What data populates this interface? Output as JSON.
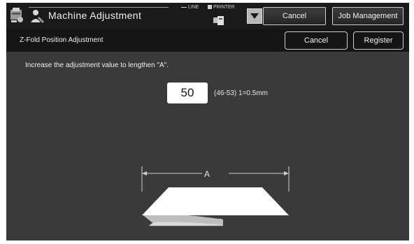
{
  "header": {
    "title": "Machine Adjustment",
    "line_label": "LINE",
    "printer_label": "PRINTER",
    "cancel_label": "Cancel",
    "job_management_label": "Job Management"
  },
  "subheader": {
    "title": "Z-Fold Position Adjustment",
    "cancel_label": "Cancel",
    "register_label": "Register"
  },
  "main": {
    "instruction": "Increase the adjustment value to lengthen \"A\".",
    "adjustment_value": "50",
    "range_text": "(46-53) 1=0.5mm",
    "dimension_label": "A"
  },
  "icons": {
    "app": "machine-adjustment-icon",
    "user": "user-icon",
    "printer": "printer-icon",
    "dropdown": "dropdown-triangle-icon"
  },
  "colors": {
    "background": "#3a3a3a",
    "topbar": "#1a1a1a",
    "subbar": "#151515",
    "value_box": "#ffffff"
  }
}
